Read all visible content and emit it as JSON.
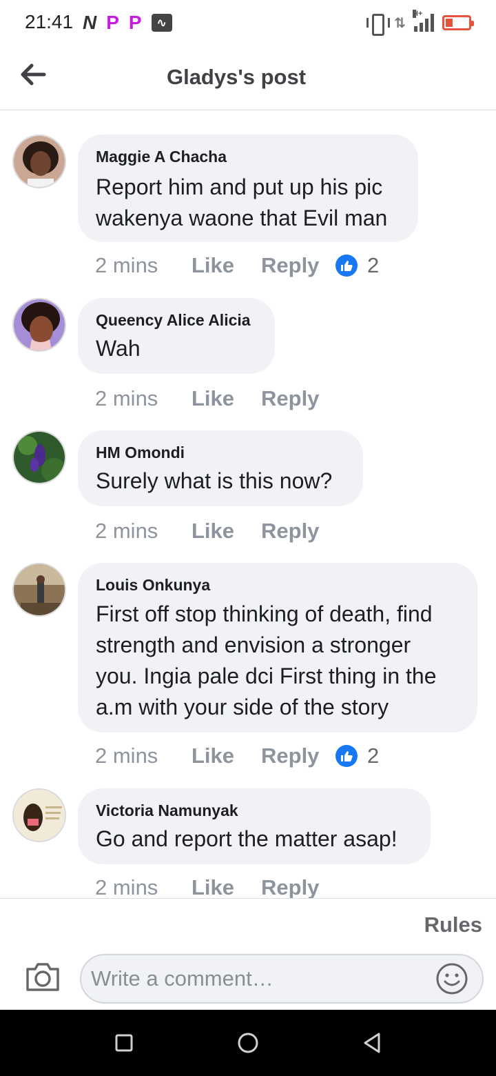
{
  "status_bar": {
    "time": "21:41",
    "left_icons": [
      "n-icon",
      "p-icon",
      "p-icon",
      "activity-icon"
    ],
    "right_icons": [
      "vibrate-icon",
      "data-arrows-icon",
      "signal-icon",
      "battery-icon"
    ],
    "network": "H+"
  },
  "header": {
    "title": "Gladys's post",
    "back_icon": "arrow-left-icon"
  },
  "comments": [
    {
      "author": "Maggie A Chacha",
      "lines": [
        "Report him and put up his pic",
        "wakenya waone that Evil man"
      ],
      "time": "2 mins",
      "like": "Like",
      "reply": "Reply",
      "reactions": "2"
    },
    {
      "author": "Queency Alice Alicia",
      "lines": [
        "Wah"
      ],
      "time": "2 mins",
      "like": "Like",
      "reply": "Reply",
      "reactions": ""
    },
    {
      "author": "HM Omondi",
      "lines": [
        "Surely what is this now?"
      ],
      "time": "2 mins",
      "like": "Like",
      "reply": "Reply",
      "reactions": ""
    },
    {
      "author": "Louis Onkunya",
      "lines": [
        "First off stop thinking of death, find",
        "strength and envision a stronger",
        "you. Ingia pale dci First thing in the",
        "a.m with your side of the story"
      ],
      "time": "2 mins",
      "like": "Like",
      "reply": "Reply",
      "reactions": "2"
    },
    {
      "author": "Victoria Namunyak",
      "lines": [
        "Go and report the matter asap!"
      ],
      "time": "2 mins",
      "like": "Like",
      "reply": "Reply",
      "reactions": ""
    }
  ],
  "composer": {
    "rules_label": "Rules",
    "placeholder": "Write a comment…",
    "camera_icon": "camera-icon",
    "emoji_icon": "emoji-icon"
  },
  "nav_bar": {
    "icons": [
      "recent-apps-icon",
      "home-icon",
      "back-icon"
    ]
  },
  "colors": {
    "bubble": "#f0f2f5",
    "like_badge": "#1877f2",
    "meta_text": "#8d949e",
    "battery": "#e5533c"
  }
}
